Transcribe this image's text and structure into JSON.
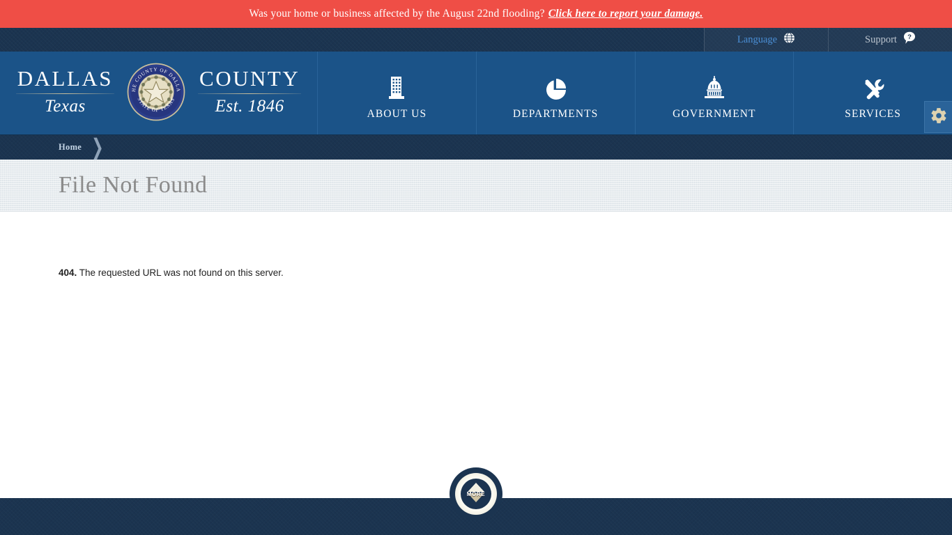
{
  "alert": {
    "message": "Was your home or business affected by the August 22nd flooding?",
    "link_text": "Click here to report your damage.",
    "background_color": "#ef4e46"
  },
  "utility": {
    "language_label": "Language",
    "language_icon": "globe-icon",
    "language_color": "#4a8fd6",
    "support_label": "Support",
    "support_icon": "question-mark-bubble-icon",
    "support_color": "#b9c2cc"
  },
  "brand": {
    "line1_left": "DALLAS",
    "line1_right": "COUNTY",
    "line2_left": "Texas",
    "line2_right": "Est. 1846",
    "seal_top_text": "THE COUNTY OF DALLAS",
    "seal_bottom_text": "STATE OF TEXAS",
    "seal_icon": "county-seal-icon"
  },
  "nav": {
    "items": [
      {
        "label": "ABOUT US",
        "icon": "building-icon"
      },
      {
        "label": "DEPARTMENTS",
        "icon": "pie-chart-icon"
      },
      {
        "label": "GOVERNMENT",
        "icon": "capitol-dome-icon"
      },
      {
        "label": "SERVICES",
        "icon": "tools-icon"
      }
    ],
    "settings_icon": "gear-icon",
    "background_color": "#1b5388"
  },
  "breadcrumb": {
    "items": [
      "Home"
    ],
    "separator": "❯"
  },
  "page": {
    "title": "File Not Found",
    "error_code": "404.",
    "error_message": "The requested URL was not found on this server."
  },
  "more_button": {
    "label": "MORE",
    "icon": "up-down-arrow-icon"
  }
}
